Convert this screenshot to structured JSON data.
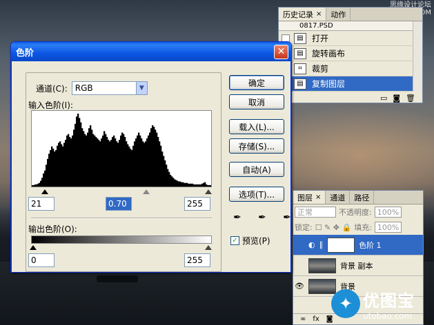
{
  "watermark_top": "思缘设计论坛 www.MISSYUAN.COM",
  "watermark_bottom": {
    "big": "优图宝",
    "small": "utobao.com"
  },
  "history_panel": {
    "tabs": [
      {
        "label": "历史记录",
        "close": "×"
      },
      {
        "label": "动作"
      }
    ],
    "top_row_text": "0817.PSD",
    "items": [
      {
        "label": "打开",
        "icon": "document-icon"
      },
      {
        "label": "旋转画布",
        "icon": "document-icon"
      },
      {
        "label": "裁剪",
        "icon": "crop-icon"
      },
      {
        "label": "复制图层",
        "icon": "document-icon",
        "selected": true
      }
    ]
  },
  "layers_panel": {
    "tabs": [
      {
        "label": "图层",
        "close": "×"
      },
      {
        "label": "通道"
      },
      {
        "label": "路径"
      }
    ],
    "blend_mode": "正常",
    "opacity_label": "不透明度:",
    "opacity_value": "100%",
    "lock_label": "锁定:",
    "fill_label": "填充:",
    "fill_value": "100%",
    "layers": [
      {
        "name": "色阶 1",
        "selected": true
      },
      {
        "name": "背景 副本",
        "selected": false
      },
      {
        "name": "背景",
        "selected": false
      }
    ]
  },
  "dialog": {
    "title": "色阶",
    "close": "✕",
    "channel_label": "通道(C):",
    "channel_value": "RGB",
    "input_levels_label": "输入色阶(I):",
    "input_black": "21",
    "input_gamma": "0.70",
    "input_white": "255",
    "output_levels_label": "输出色阶(O):",
    "output_black": "0",
    "output_white": "255",
    "buttons": {
      "ok": "确定",
      "cancel": "取消",
      "load": "载入(L)...",
      "save": "存储(S)...",
      "auto": "自动(A)",
      "options": "选项(T)..."
    },
    "preview_label": "预览(P)",
    "preview_checked": true
  },
  "histogram": [
    2,
    2,
    3,
    3,
    4,
    5,
    8,
    12,
    18,
    22,
    30,
    38,
    45,
    50,
    55,
    52,
    48,
    50,
    56,
    60,
    62,
    58,
    55,
    60,
    64,
    70,
    72,
    68,
    66,
    70,
    78,
    86,
    96,
    100,
    94,
    88,
    80,
    76,
    72,
    70,
    74,
    80,
    84,
    78,
    72,
    70,
    68,
    66,
    64,
    62,
    66,
    70,
    76,
    72,
    68,
    64,
    62,
    64,
    68,
    70,
    66,
    62,
    60,
    64,
    70,
    74,
    72,
    68,
    62,
    58,
    55,
    52,
    50,
    56,
    62,
    66,
    70,
    74,
    70,
    66,
    62,
    60,
    62,
    66,
    70,
    74,
    80,
    84,
    82,
    78,
    74,
    68,
    62,
    56,
    48,
    42,
    36,
    30,
    24,
    20,
    16,
    14,
    12,
    10,
    9,
    8,
    7,
    7,
    6,
    6,
    5,
    5,
    5,
    4,
    4,
    4,
    4,
    3,
    3,
    3,
    3,
    3,
    3,
    4,
    5,
    6,
    3,
    2,
    2,
    2
  ]
}
